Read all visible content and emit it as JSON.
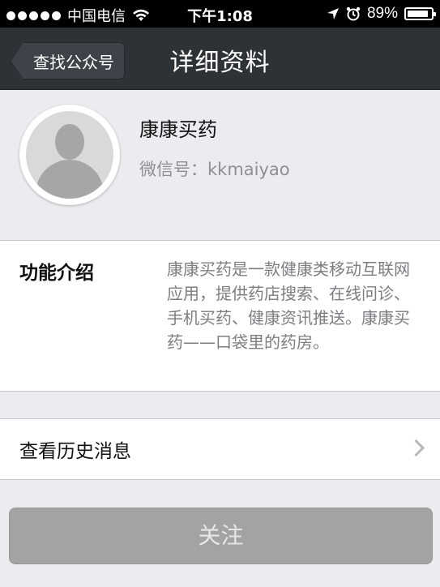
{
  "status_bar": {
    "carrier": "中国电信",
    "time": "下午1:08",
    "battery_text": "89%",
    "battery_level": 0.89
  },
  "nav": {
    "back_label": "查找公众号",
    "title": "详细资料"
  },
  "profile": {
    "name": "康康买药",
    "wechat_id": "微信号：kkmaiyao"
  },
  "intro": {
    "label": "功能介绍",
    "description": "康康买药是一款健康类移动互联网应用，提供药店搜索、在线问诊、手机买药、健康资讯推送。康康买药——口袋里的药房。"
  },
  "history": {
    "label": "查看历史消息"
  },
  "follow_button": {
    "label": "关注"
  }
}
